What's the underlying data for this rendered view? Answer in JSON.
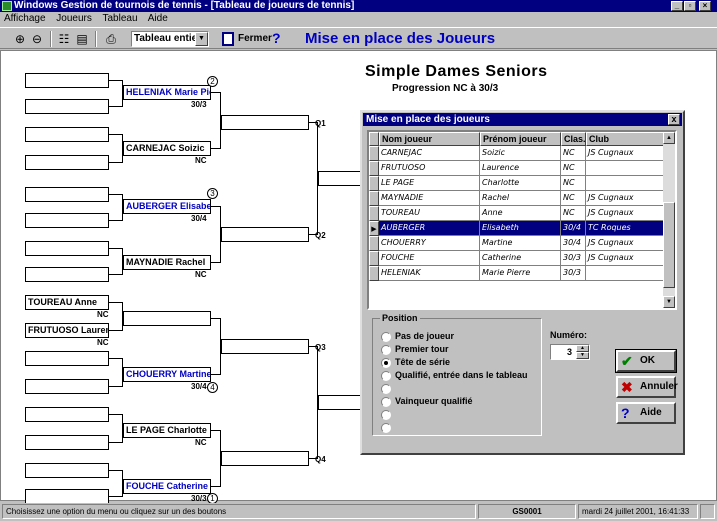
{
  "window": {
    "title": "Windows Gestion de tournois de tennis - [Tableau de joueurs de tennis]"
  },
  "menu": [
    "Affichage",
    "Joueurs",
    "Tableau",
    "Aide"
  ],
  "toolbar": {
    "view_select": "Tableau entier",
    "close_label": "Fermer",
    "help_label": "?",
    "mode_title": "Mise en place des Joueurs"
  },
  "bracket": {
    "title": "Simple Dames Seniors",
    "subtitle": "Progression NC à 30/3",
    "slots": [
      {
        "name": "HELENIAK Marie Pierr",
        "rank": "30/3",
        "seed": "2",
        "blue": true
      },
      {
        "name": "CARNEJAC Soizic",
        "rank": "NC",
        "seed": "",
        "blue": false
      },
      {
        "name": "AUBERGER Elisabeth",
        "rank": "30/4",
        "seed": "3",
        "blue": true
      },
      {
        "name": "MAYNADIE Rachel",
        "rank": "NC",
        "seed": "",
        "blue": false
      },
      {
        "name": "TOUREAU Anne",
        "rank": "NC",
        "seed": "",
        "blue": false
      },
      {
        "name": "FRUTUOSO Laurence",
        "rank": "NC",
        "seed": "",
        "blue": false
      },
      {
        "name": "CHOUERRY Martine",
        "rank": "30/4",
        "seed": "4",
        "blue": true
      },
      {
        "name": "LE PAGE Charlotte",
        "rank": "NC",
        "seed": "",
        "blue": false
      },
      {
        "name": "FOUCHE Catherine",
        "rank": "30/3",
        "seed": "1",
        "blue": true
      }
    ],
    "qualifiers": [
      "Q1",
      "Q2",
      "Q3",
      "Q4"
    ]
  },
  "dialog": {
    "title": "Mise en place des joueurs",
    "close_label": "x",
    "columns": [
      "Nom joueur",
      "Prénom joueur",
      "Clas.",
      "Club"
    ],
    "rows": [
      {
        "nom": "CARNEJAC",
        "prenom": "Soizic",
        "clas": "NC",
        "club": "JS Cugnaux",
        "selected": false
      },
      {
        "nom": "FRUTUOSO",
        "prenom": "Laurence",
        "clas": "NC",
        "club": "",
        "selected": false
      },
      {
        "nom": "LE PAGE",
        "prenom": "Charlotte",
        "clas": "NC",
        "club": "",
        "selected": false
      },
      {
        "nom": "MAYNADIE",
        "prenom": "Rachel",
        "clas": "NC",
        "club": "JS Cugnaux",
        "selected": false
      },
      {
        "nom": "TOUREAU",
        "prenom": "Anne",
        "clas": "NC",
        "club": "JS Cugnaux",
        "selected": false
      },
      {
        "nom": "AUBERGER",
        "prenom": "Elisabeth",
        "clas": "30/4",
        "club": "TC Roques",
        "selected": true
      },
      {
        "nom": "CHOUERRY",
        "prenom": "Martine",
        "clas": "30/4",
        "club": "JS Cugnaux",
        "selected": false
      },
      {
        "nom": "FOUCHE",
        "prenom": "Catherine",
        "clas": "30/3",
        "club": "JS Cugnaux",
        "selected": false
      },
      {
        "nom": "HELENIAK",
        "prenom": "Marie Pierre",
        "clas": "30/3",
        "club": "",
        "selected": false
      }
    ],
    "position": {
      "legend": "Position",
      "options": [
        "Pas de joueur",
        "Premier tour",
        "Tête de série",
        "Qualifié, entrée dans le tableau",
        "",
        "Vainqueur qualifié",
        "",
        ""
      ],
      "selected_index": 2
    },
    "numero": {
      "label": "Numéro:",
      "value": "3"
    },
    "buttons": {
      "ok": "OK",
      "cancel": "Annuler",
      "help": "Aide"
    }
  },
  "status": {
    "hint": "Choisissez une option du menu ou cliquez sur un des boutons",
    "code": "GS0001",
    "datetime": "mardi 24 juillet 2001,   16:41:33"
  }
}
